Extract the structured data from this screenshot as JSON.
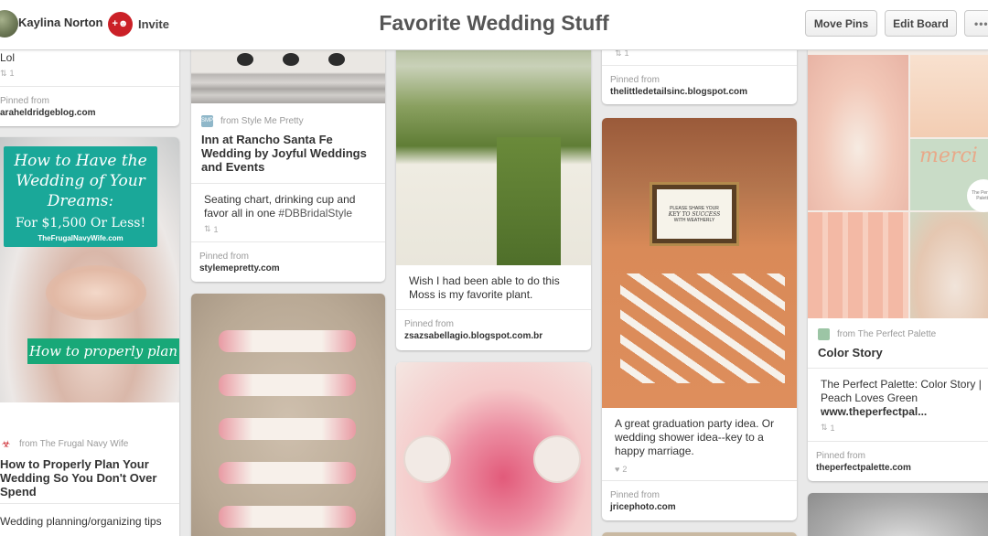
{
  "header": {
    "user_name": "Kaylina Norton",
    "invite_label": "Invite",
    "board_title": "Favorite Wedding Stuff",
    "move_pins_label": "Move Pins",
    "edit_board_label": "Edit Board",
    "more_label": "•••"
  },
  "pins": {
    "c1a": {
      "desc": "Lol",
      "repins": "1",
      "pinned_from": "Pinned from",
      "source": "araheldridgeblog.com"
    },
    "c1b": {
      "overlay_line1": "How to Have the",
      "overlay_line2": "Wedding of Your",
      "overlay_line3": "Dreams:",
      "overlay_line4": "For $1,500 Or Less!",
      "overlay_site": "TheFrugalNavyWife.com",
      "overlay_banner": "How to properly plan",
      "via": "from The Frugal Navy Wife",
      "title": "How to Properly Plan Your Wedding So You Don't Over Spend",
      "desc": "Wedding planning/organizing tips"
    },
    "c2a": {
      "via": "from Style Me Pretty",
      "via_icon": "SMP",
      "title": "Inn at Rancho Santa Fe Wedding by Joyful Weddings and Events",
      "desc_plain": "Seating chart, drinking cup and favor all in one ",
      "desc_tag": "#DBBridalStyle",
      "repins": "1",
      "pinned_from": "Pinned from",
      "source": "stylemepretty.com"
    },
    "c3a": {
      "desc": "Wish I had been able to do this Moss is my favorite plant.",
      "pinned_from": "Pinned from",
      "source": "zsazsabellagio.blogspot.com.br"
    },
    "c4a": {
      "repins": "1",
      "pinned_from": "Pinned from",
      "source": "thelittledetailsinc.blogspot.com"
    },
    "c4b": {
      "sign_line1": "PLEASE SHARE YOUR",
      "sign_line2": "KEY TO SUCCESS",
      "sign_line3": "WITH WEATHERLY",
      "desc": "A great graduation party idea. Or wedding shower idea--key to a happy marriage.",
      "likes": "2",
      "pinned_from": "Pinned from",
      "source": "jricephoto.com"
    },
    "c5a": {
      "collage_text": "merci",
      "corner_text": "The Perfect Palette",
      "via": "from The Perfect Palette",
      "title": "Color Story",
      "desc_plain": "The Perfect Palette: Color Story | Peach Loves Green ",
      "desc_link": "www.theperfectpal...",
      "repins": "1",
      "pinned_from": "Pinned from",
      "source": "theperfectpalette.com"
    }
  },
  "colors": {
    "accent": "#cb2027",
    "teal": "#1aa899",
    "green_banner": "#18a878"
  }
}
